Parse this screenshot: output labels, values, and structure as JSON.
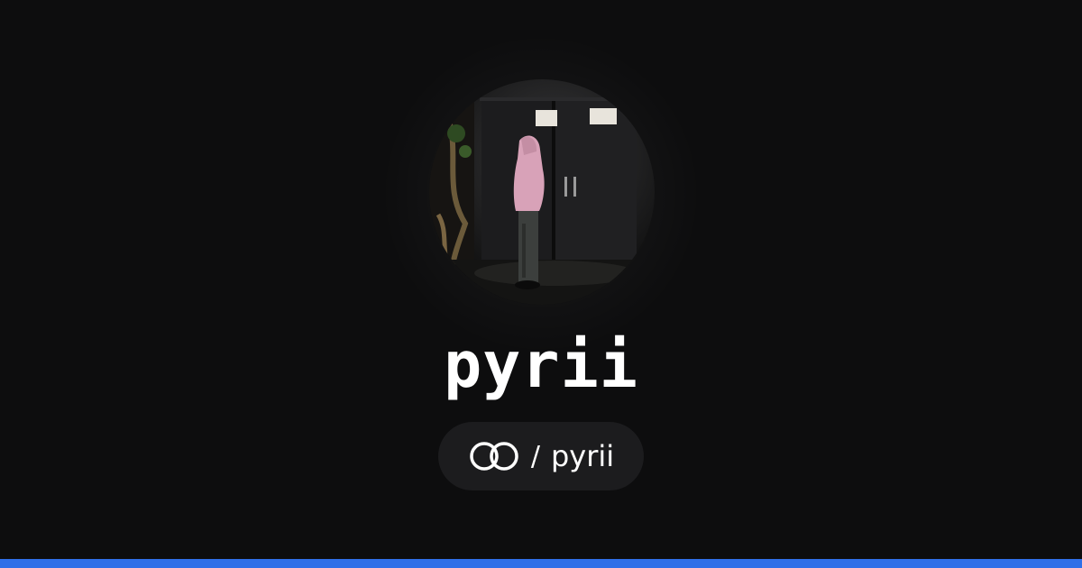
{
  "profile": {
    "display_name": "pyrii",
    "avatar_icon": "profile-photo",
    "link": {
      "logo_icon": "linked-rings-icon",
      "separator": "/",
      "handle": "pyrii"
    }
  },
  "colors": {
    "background": "#0d0d0e",
    "pill_background": "#1c1c1e",
    "text": "#ffffff",
    "accent_bar": "#2f6fe8"
  }
}
